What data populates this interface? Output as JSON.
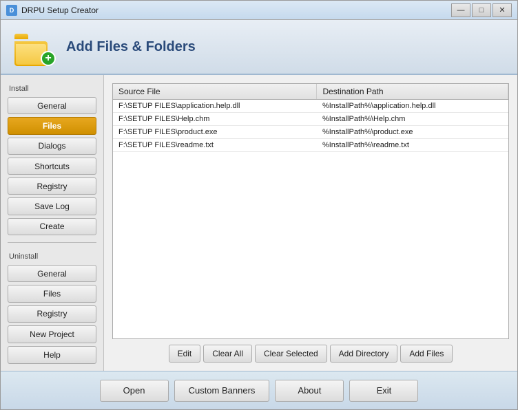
{
  "window": {
    "title": "DRPU Setup Creator",
    "controls": {
      "minimize": "—",
      "maximize": "□",
      "close": "✕"
    }
  },
  "header": {
    "title": "Add Files & Folders"
  },
  "sidebar": {
    "install_label": "Install",
    "install_items": [
      {
        "id": "general",
        "label": "General",
        "active": false
      },
      {
        "id": "files",
        "label": "Files",
        "active": true
      },
      {
        "id": "dialogs",
        "label": "Dialogs",
        "active": false
      },
      {
        "id": "shortcuts",
        "label": "Shortcuts",
        "active": false
      },
      {
        "id": "registry",
        "label": "Registry",
        "active": false
      },
      {
        "id": "save-log",
        "label": "Save Log",
        "active": false
      },
      {
        "id": "create",
        "label": "Create",
        "active": false
      }
    ],
    "uninstall_label": "Uninstall",
    "uninstall_items": [
      {
        "id": "u-general",
        "label": "General",
        "active": false
      },
      {
        "id": "u-files",
        "label": "Files",
        "active": false
      },
      {
        "id": "u-registry",
        "label": "Registry",
        "active": false
      }
    ],
    "bottom_items": [
      {
        "id": "new-project",
        "label": "New Project"
      },
      {
        "id": "help",
        "label": "Help"
      }
    ]
  },
  "table": {
    "columns": [
      {
        "id": "source",
        "label": "Source File"
      },
      {
        "id": "dest",
        "label": "Destination Path"
      }
    ],
    "rows": [
      {
        "source": "F:\\SETUP FILES\\application.help.dll",
        "dest": "%InstallPath%\\application.help.dll"
      },
      {
        "source": "F:\\SETUP FILES\\Help.chm",
        "dest": "%InstallPath%\\Help.chm"
      },
      {
        "source": "F:\\SETUP FILES\\product.exe",
        "dest": "%InstallPath%\\product.exe"
      },
      {
        "source": "F:\\SETUP FILES\\readme.txt",
        "dest": "%InstallPath%\\readme.txt"
      }
    ]
  },
  "table_buttons": {
    "edit": "Edit",
    "clear_all": "Clear All",
    "clear_selected": "Clear Selected",
    "add_directory": "Add Directory",
    "add_files": "Add Files"
  },
  "bottom_buttons": {
    "open": "Open",
    "custom_banners": "Custom Banners",
    "about": "About",
    "exit": "Exit"
  }
}
